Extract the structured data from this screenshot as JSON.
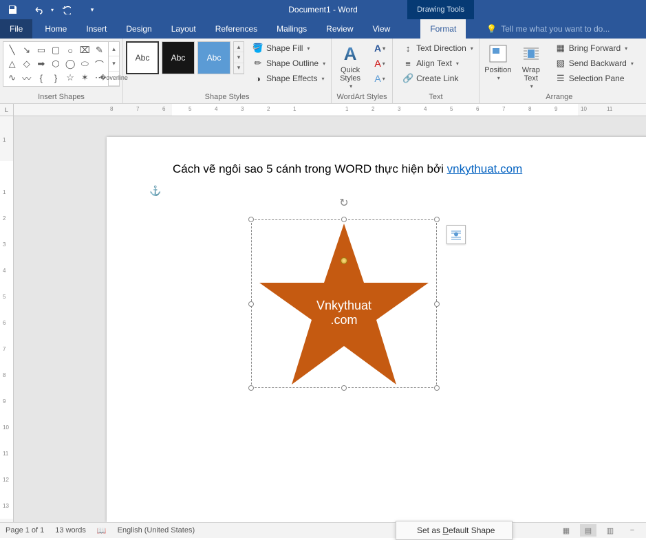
{
  "title": "Document1 - Word",
  "context_tab_title": "Drawing Tools",
  "tabs": {
    "file": "File",
    "home": "Home",
    "insert": "Insert",
    "design": "Design",
    "layout": "Layout",
    "references": "References",
    "mailings": "Mailings",
    "review": "Review",
    "view": "View",
    "format": "Format"
  },
  "tell_me": "Tell me what you want to do...",
  "groups": {
    "insert_shapes": "Insert Shapes",
    "shape_styles": "Shape Styles",
    "wordart_styles": "WordArt Styles",
    "text": "Text",
    "arrange": "Arrange"
  },
  "style_sample": "Abc",
  "shape_fill": "Shape Fill",
  "shape_outline": "Shape Outline",
  "shape_effects": "Shape Effects",
  "quick_styles": "Quick\nStyles",
  "text_direction": "Text Direction",
  "align_text": "Align Text",
  "create_link": "Create Link",
  "position": "Position",
  "wrap_text": "Wrap\nText",
  "bring_forward": "Bring Forward",
  "send_backward": "Send Backward",
  "selection_pane": "Selection Pane",
  "ruler_corner": "L",
  "doc": {
    "text_prefix": "Cách vẽ ngôi sao 5 cánh trong WORD thực hiện bởi ",
    "link_text": "vnkythuat.com",
    "star_line1": "Vnkythuat",
    "star_line2": ".com"
  },
  "status": {
    "page": "Page 1 of 1",
    "words": "13 words",
    "lang": "English (United States)"
  },
  "ctx": {
    "default_shape": "Set as Default Shape"
  },
  "ruler_h": [
    "8",
    "7",
    "6",
    "5",
    "4",
    "3",
    "2",
    "1",
    "",
    "1",
    "2",
    "3",
    "4",
    "5",
    "6",
    "7",
    "8",
    "9",
    "10",
    "11"
  ],
  "ruler_v": [
    "1",
    "",
    "1",
    "2",
    "3",
    "4",
    "5",
    "6",
    "7",
    "8",
    "9",
    "10",
    "11",
    "12",
    "13"
  ]
}
